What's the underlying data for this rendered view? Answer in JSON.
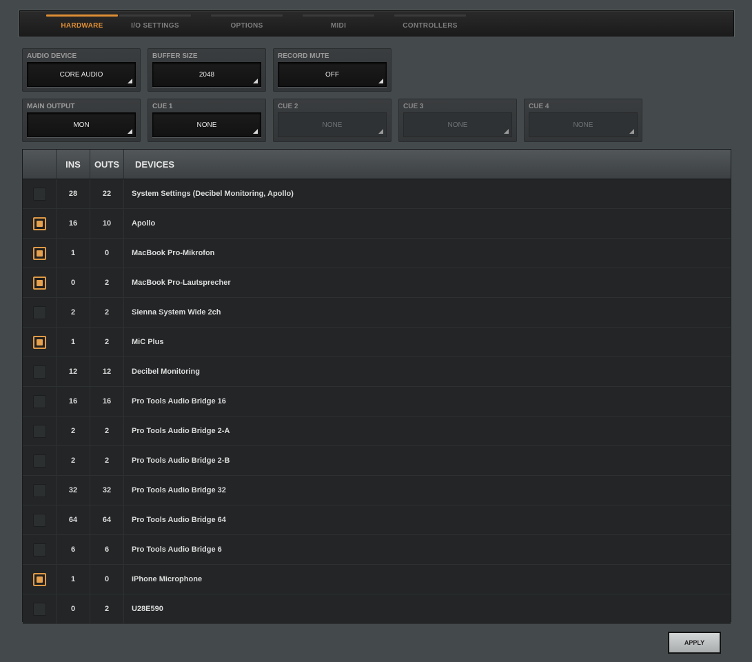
{
  "tabs": [
    {
      "label": "HARDWARE",
      "active": true
    },
    {
      "label": "I/O SETTINGS",
      "active": false
    },
    {
      "label": "OPTIONS",
      "active": false
    },
    {
      "label": "MIDI",
      "active": false
    },
    {
      "label": "CONTROLLERS",
      "active": false
    }
  ],
  "settings": {
    "audio_device": {
      "caption": "AUDIO DEVICE",
      "value": "CORE AUDIO"
    },
    "buffer_size": {
      "caption": "BUFFER SIZE",
      "value": "2048"
    },
    "record_mute": {
      "caption": "RECORD MUTE",
      "value": "OFF"
    },
    "main_output": {
      "caption": "MAIN OUTPUT",
      "value": "MON"
    },
    "cue1": {
      "caption": "CUE 1",
      "value": "NONE"
    },
    "cue2": {
      "caption": "CUE 2",
      "value": "NONE"
    },
    "cue3": {
      "caption": "CUE 3",
      "value": "NONE"
    },
    "cue4": {
      "caption": "CUE 4",
      "value": "NONE"
    }
  },
  "table": {
    "headers": {
      "ins": "INS",
      "outs": "OUTS",
      "devices": "DEVICES"
    },
    "rows": [
      {
        "checked": false,
        "ins": "28",
        "outs": "22",
        "name": "System Settings (Decibel Monitoring, Apollo)"
      },
      {
        "checked": true,
        "ins": "16",
        "outs": "10",
        "name": "Apollo"
      },
      {
        "checked": true,
        "ins": "1",
        "outs": "0",
        "name": "MacBook Pro-Mikrofon"
      },
      {
        "checked": true,
        "ins": "0",
        "outs": "2",
        "name": "MacBook Pro-Lautsprecher"
      },
      {
        "checked": false,
        "ins": "2",
        "outs": "2",
        "name": "Sienna System Wide 2ch"
      },
      {
        "checked": true,
        "ins": "1",
        "outs": "2",
        "name": "MiC Plus"
      },
      {
        "checked": false,
        "ins": "12",
        "outs": "12",
        "name": "Decibel Monitoring"
      },
      {
        "checked": false,
        "ins": "16",
        "outs": "16",
        "name": "Pro Tools Audio Bridge 16"
      },
      {
        "checked": false,
        "ins": "2",
        "outs": "2",
        "name": "Pro Tools Audio Bridge 2-A"
      },
      {
        "checked": false,
        "ins": "2",
        "outs": "2",
        "name": "Pro Tools Audio Bridge 2-B"
      },
      {
        "checked": false,
        "ins": "32",
        "outs": "32",
        "name": "Pro Tools Audio Bridge 32"
      },
      {
        "checked": false,
        "ins": "64",
        "outs": "64",
        "name": "Pro Tools Audio Bridge 64"
      },
      {
        "checked": false,
        "ins": "6",
        "outs": "6",
        "name": "Pro Tools Audio Bridge 6"
      },
      {
        "checked": true,
        "ins": "1",
        "outs": "0",
        "name": "iPhone Microphone"
      },
      {
        "checked": false,
        "ins": "0",
        "outs": "2",
        "name": "U28E590"
      }
    ]
  },
  "apply_label": "APPLY",
  "colors": {
    "accent": "#e08f35",
    "background": "#444a4c"
  }
}
